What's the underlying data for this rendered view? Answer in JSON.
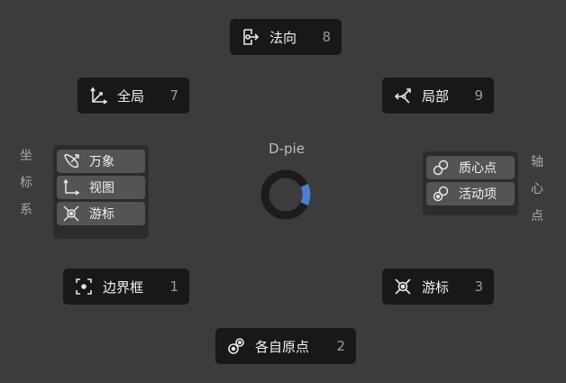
{
  "pie": {
    "title": "D-pie",
    "accent_color": "#4a7fd1",
    "ring_color": "#1c1c1c"
  },
  "buttons": {
    "normal": {
      "label": "法向",
      "key": "8",
      "icon": "normal-arrow-icon"
    },
    "global": {
      "label": "全局",
      "key": "7",
      "icon": "global-axes-icon"
    },
    "local": {
      "label": "局部",
      "key": "9",
      "icon": "local-axes-icon"
    },
    "bound_box": {
      "label": "边界框",
      "key": "1",
      "icon": "bounding-box-center-icon"
    },
    "cursor": {
      "label": "游标",
      "key": "3",
      "icon": "3d-cursor-icon"
    },
    "individual_origins": {
      "label": "各自原点",
      "key": "2",
      "icon": "individual-origins-icon"
    }
  },
  "coordinate_panel": {
    "side_label": [
      "坐",
      "标",
      "系"
    ],
    "items": [
      {
        "label": "万象",
        "icon": "gimbal-icon"
      },
      {
        "label": "视图",
        "icon": "view-axes-icon"
      },
      {
        "label": "游标",
        "icon": "cursor-orientation-icon"
      }
    ]
  },
  "pivot_panel": {
    "side_label": [
      "轴",
      "心",
      "点"
    ],
    "items": [
      {
        "label": "质心点",
        "icon": "median-point-icon"
      },
      {
        "label": "活动项",
        "icon": "active-element-icon"
      }
    ]
  }
}
